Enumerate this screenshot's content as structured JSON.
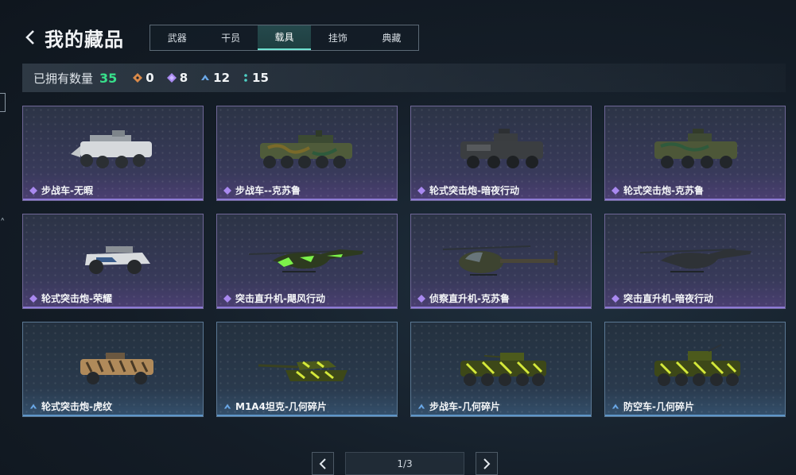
{
  "header": {
    "title": "我的藏品",
    "back_icon": "chevron-left-icon"
  },
  "tabs": [
    {
      "label": "武器",
      "active": false
    },
    {
      "label": "干员",
      "active": false
    },
    {
      "label": "载具",
      "active": true
    },
    {
      "label": "挂饰",
      "active": false
    },
    {
      "label": "典藏",
      "active": false
    }
  ],
  "stats": {
    "label": "已拥有数量",
    "total": "35",
    "items": [
      {
        "icon": "orange-diamond-icon",
        "color": "#d98a4a",
        "count": "0"
      },
      {
        "icon": "purple-diamond-icon",
        "color": "#a989f0",
        "count": "8"
      },
      {
        "icon": "blue-chevron-icon",
        "color": "#6aa8e8",
        "count": "12"
      },
      {
        "icon": "teal-dots-icon",
        "color": "#4fd1c5",
        "count": "15"
      }
    ]
  },
  "collection": [
    {
      "name": "步战车-无暇",
      "rarity": "purple",
      "vehicle": "ifv-white"
    },
    {
      "name": "步战车--克苏鲁",
      "rarity": "purple",
      "vehicle": "ifv-camo"
    },
    {
      "name": "轮式突击炮-暗夜行动",
      "rarity": "purple",
      "vehicle": "assault-gun-dark"
    },
    {
      "name": "轮式突击炮-克苏鲁",
      "rarity": "purple",
      "vehicle": "assault-gun-camo"
    },
    {
      "name": "轮式突击炮-荣耀",
      "rarity": "purple",
      "vehicle": "buggy-white"
    },
    {
      "name": "突击直升机-飓风行动",
      "rarity": "purple",
      "vehicle": "attack-heli-green"
    },
    {
      "name": "侦察直升机-克苏鲁",
      "rarity": "purple",
      "vehicle": "scout-heli-camo"
    },
    {
      "name": "突击直升机-暗夜行动",
      "rarity": "purple",
      "vehicle": "attack-heli-dark"
    },
    {
      "name": "轮式突击炮-虎纹",
      "rarity": "blue",
      "vehicle": "assault-gun-tiger"
    },
    {
      "name": "M1A4坦克-几何碎片",
      "rarity": "blue",
      "vehicle": "tank-geo"
    },
    {
      "name": "步战车-几何碎片",
      "rarity": "blue",
      "vehicle": "ifv-geo"
    },
    {
      "name": "防空车-几何碎片",
      "rarity": "blue",
      "vehicle": "aa-geo"
    }
  ],
  "pagination": {
    "page": "1/3",
    "prev_icon": "chevron-left-icon",
    "next_icon": "chevron-right-icon"
  }
}
